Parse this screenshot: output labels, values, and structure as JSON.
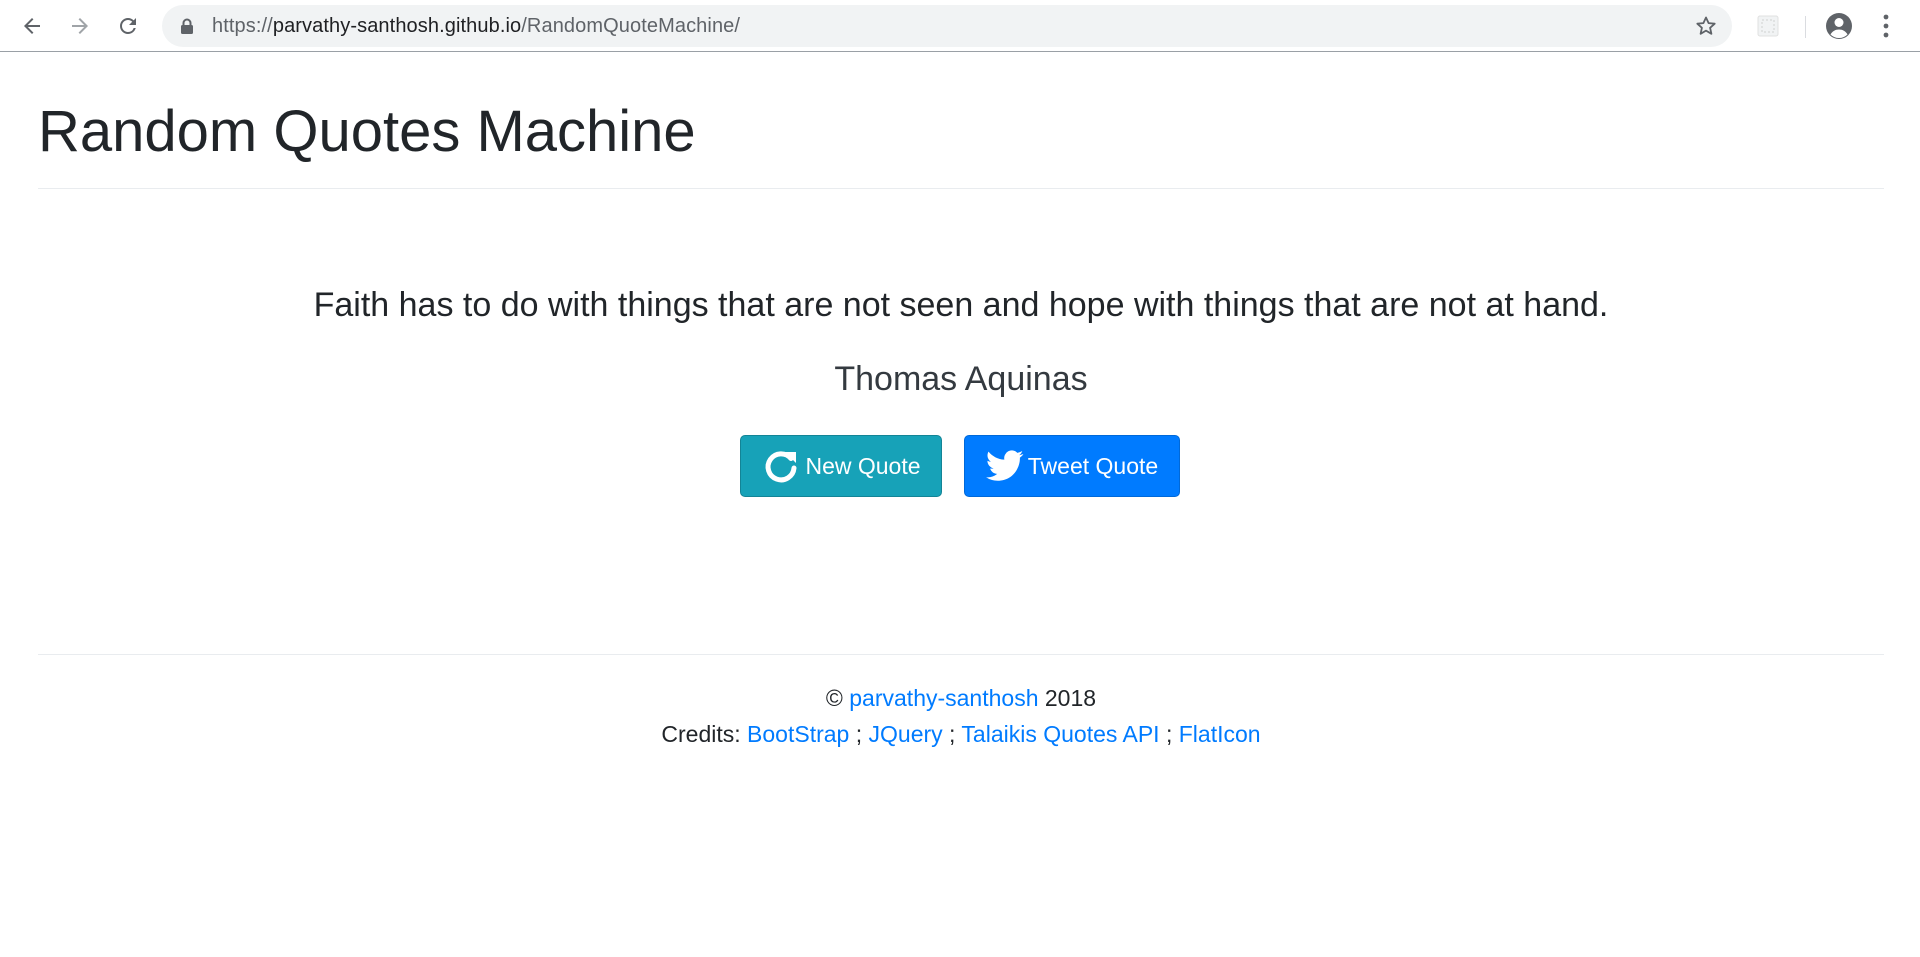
{
  "browser": {
    "url_scheme": "https://",
    "url_host": "parvathy-santhosh.github.io",
    "url_path": "/RandomQuoteMachine/",
    "icons": [
      "back-arrow-icon",
      "forward-arrow-icon",
      "reload-icon",
      "lock-icon",
      "star-icon",
      "extension-icon",
      "account-icon",
      "more-vert-icon"
    ]
  },
  "header": {
    "title": "Random Quotes Machine"
  },
  "quote": {
    "text": "Faith has to do with things that are not seen and hope with things that are not at hand.",
    "author": "Thomas Aquinas"
  },
  "buttons": {
    "new_quote": "New Quote",
    "tweet_quote": "Tweet Quote"
  },
  "footer": {
    "copyright_symbol": "©",
    "author_link": "parvathy-santhosh",
    "year": "2018",
    "credits_label": "Credits:",
    "separator": ";",
    "credits": [
      "BootStrap",
      "JQuery",
      "Talaikis Quotes API",
      "FlatIcon"
    ]
  },
  "colors": {
    "info_button": "#17a2b8",
    "primary_button": "#007bff",
    "link": "#007bff",
    "text": "#212529"
  }
}
